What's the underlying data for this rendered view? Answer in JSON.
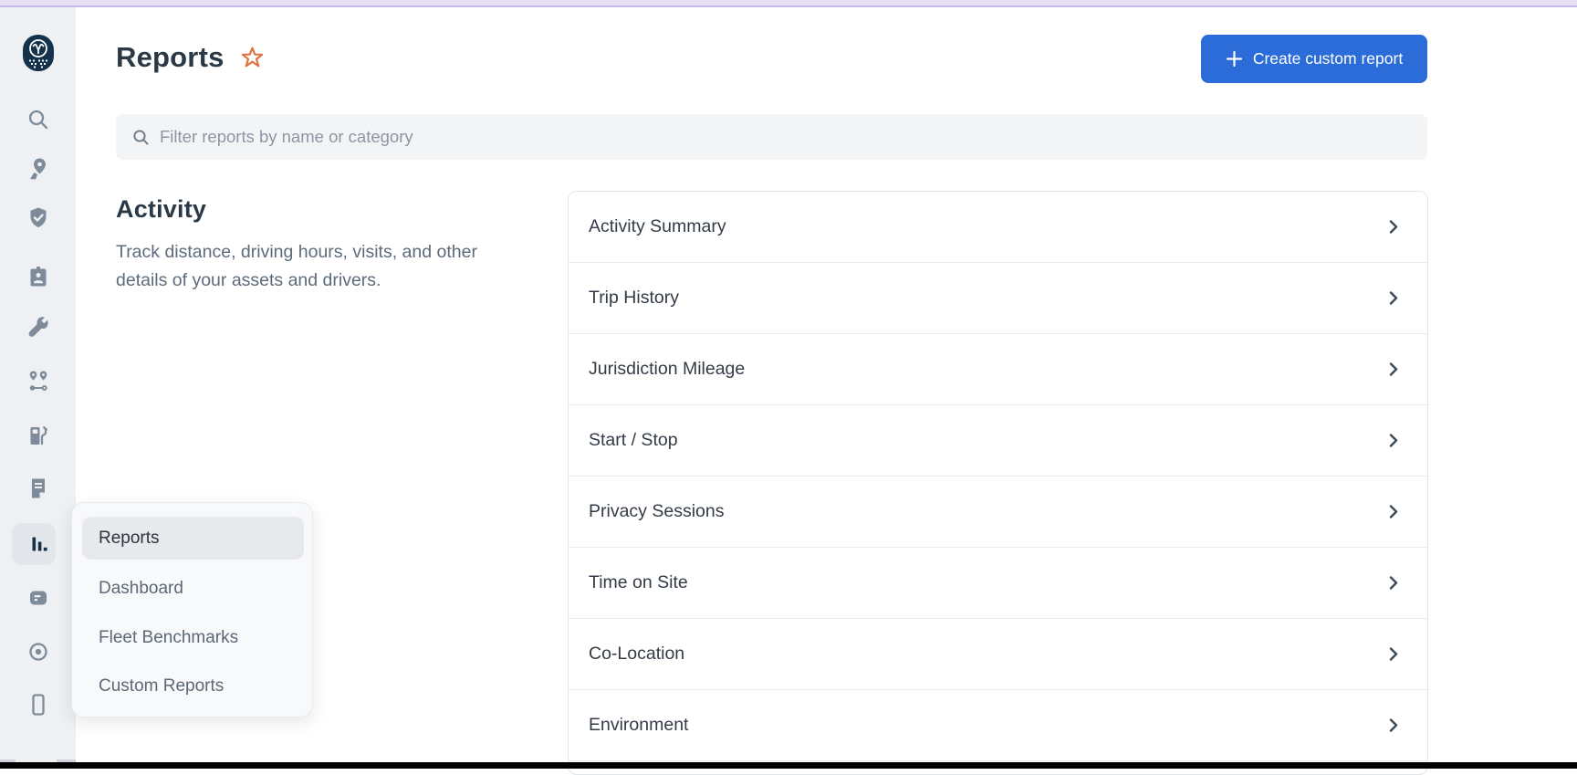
{
  "app": {
    "name": "fleet-web-app",
    "colors": {
      "accent_blue": "#2b6cd9",
      "star_orange": "#e0703a",
      "brand_navy": "#14324b",
      "sidebar_bg": "#eef0f3",
      "top_strip_lavender": "#e6e1f7",
      "bottom_bar_black": "#010101"
    }
  },
  "sidebar": {
    "icons": [
      {
        "name": "owl-logo"
      },
      {
        "name": "search-icon"
      },
      {
        "name": "map-pin-icon"
      },
      {
        "name": "shield-check-icon"
      },
      {
        "name": "id-badge-icon"
      },
      {
        "name": "wrench-icon"
      },
      {
        "name": "route-icon"
      },
      {
        "name": "fuel-pump-icon"
      },
      {
        "name": "document-icon"
      },
      {
        "name": "bar-chart-icon",
        "active": true
      },
      {
        "name": "message-card-icon"
      },
      {
        "name": "record-circle-icon"
      },
      {
        "name": "mobile-phone-icon"
      }
    ]
  },
  "header": {
    "title": "Reports",
    "star_icon": "star-outline",
    "create_button": {
      "plus": "+",
      "label": "Create custom report"
    }
  },
  "filter": {
    "placeholder": "Filter reports by name or category",
    "value": ""
  },
  "section": {
    "title": "Activity",
    "description": "Track distance, driving hours, visits, and other details of your assets and drivers."
  },
  "reports": {
    "items": [
      {
        "label": "Activity Summary"
      },
      {
        "label": "Trip History"
      },
      {
        "label": "Jurisdiction Mileage"
      },
      {
        "label": "Start / Stop"
      },
      {
        "label": "Privacy Sessions"
      },
      {
        "label": "Time on Site"
      },
      {
        "label": "Co-Location"
      },
      {
        "label": "Environment"
      }
    ]
  },
  "flyout": {
    "items": [
      {
        "label": "Reports",
        "active": true
      },
      {
        "label": "Dashboard",
        "active": false
      },
      {
        "label": "Fleet Benchmarks",
        "active": false
      },
      {
        "label": "Custom Reports",
        "active": false
      }
    ]
  }
}
